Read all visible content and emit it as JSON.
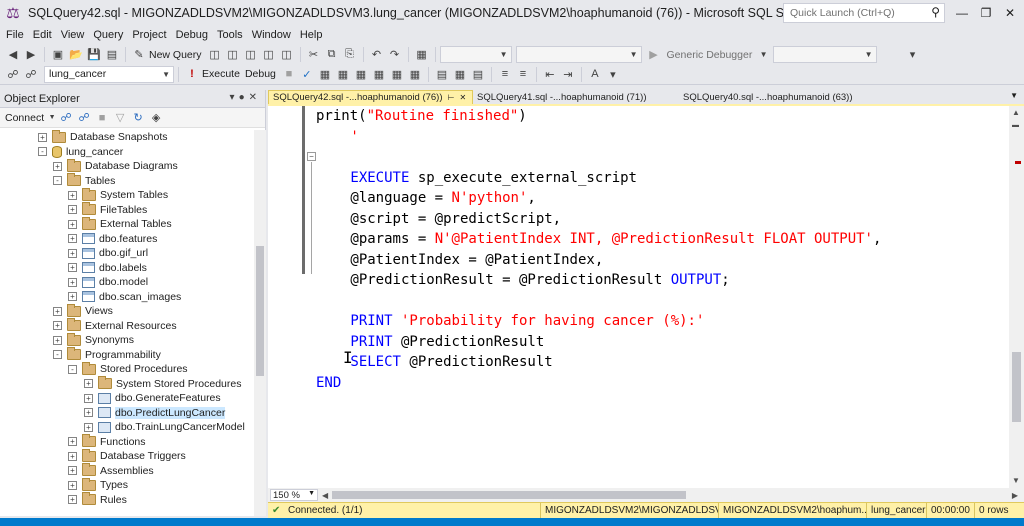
{
  "window": {
    "title": "SQLQuery42.sql - MIGONZADLDSVM2\\MIGONZADLDSVM3.lung_cancer (MIGONZADLDSVM2\\hoaphumanoid (76)) - Microsoft SQL Server...",
    "quick_launch_placeholder": "Quick Launch (Ctrl+Q)"
  },
  "menu": [
    "File",
    "Edit",
    "View",
    "Query",
    "Project",
    "Debug",
    "Tools",
    "Window",
    "Help"
  ],
  "toolbar1": {
    "new_query": "New Query",
    "debugger": "Generic Debugger"
  },
  "toolbar2": {
    "database": "lung_cancer",
    "execute": "Execute",
    "debug": "Debug"
  },
  "object_explorer": {
    "title": "Object Explorer",
    "connect": "Connect",
    "tree": [
      {
        "label": "Database Snapshots",
        "icon": "folder-icon",
        "level": 2,
        "expander": "+"
      },
      {
        "label": "lung_cancer",
        "icon": "database-icon",
        "level": 2,
        "expander": "-"
      },
      {
        "label": "Database Diagrams",
        "icon": "folder-icon",
        "level": 3,
        "expander": "+"
      },
      {
        "label": "Tables",
        "icon": "folder-icon",
        "level": 3,
        "expander": "-"
      },
      {
        "label": "System Tables",
        "icon": "folder-icon",
        "level": 4,
        "expander": "+"
      },
      {
        "label": "FileTables",
        "icon": "folder-icon",
        "level": 4,
        "expander": "+"
      },
      {
        "label": "External Tables",
        "icon": "folder-icon",
        "level": 4,
        "expander": "+"
      },
      {
        "label": "dbo.features",
        "icon": "table-icon",
        "level": 4,
        "expander": "+"
      },
      {
        "label": "dbo.gif_url",
        "icon": "table-icon",
        "level": 4,
        "expander": "+"
      },
      {
        "label": "dbo.labels",
        "icon": "table-icon",
        "level": 4,
        "expander": "+"
      },
      {
        "label": "dbo.model",
        "icon": "table-icon",
        "level": 4,
        "expander": "+"
      },
      {
        "label": "dbo.scan_images",
        "icon": "table-icon",
        "level": 4,
        "expander": "+"
      },
      {
        "label": "Views",
        "icon": "folder-icon",
        "level": 3,
        "expander": "+"
      },
      {
        "label": "External Resources",
        "icon": "folder-icon",
        "level": 3,
        "expander": "+"
      },
      {
        "label": "Synonyms",
        "icon": "folder-icon",
        "level": 3,
        "expander": "+"
      },
      {
        "label": "Programmability",
        "icon": "folder-icon",
        "level": 3,
        "expander": "-"
      },
      {
        "label": "Stored Procedures",
        "icon": "folder-icon",
        "level": 4,
        "expander": "-"
      },
      {
        "label": "System Stored Procedures",
        "icon": "folder-icon",
        "level": 5,
        "expander": "+"
      },
      {
        "label": "dbo.GenerateFeatures",
        "icon": "procedure-icon",
        "level": 5,
        "expander": "+"
      },
      {
        "label": "dbo.PredictLungCancer",
        "icon": "procedure-icon",
        "level": 5,
        "expander": "+",
        "selected": true
      },
      {
        "label": "dbo.TrainLungCancerModel",
        "icon": "procedure-icon",
        "level": 5,
        "expander": "+"
      },
      {
        "label": "Functions",
        "icon": "folder-icon",
        "level": 4,
        "expander": "+"
      },
      {
        "label": "Database Triggers",
        "icon": "folder-icon",
        "level": 4,
        "expander": "+"
      },
      {
        "label": "Assemblies",
        "icon": "folder-icon",
        "level": 4,
        "expander": "+"
      },
      {
        "label": "Types",
        "icon": "folder-icon",
        "level": 4,
        "expander": "+"
      },
      {
        "label": "Rules",
        "icon": "folder-icon",
        "level": 4,
        "expander": "+"
      }
    ]
  },
  "tabs": [
    {
      "label": "SQLQuery42.sql -...hoaphumanoid (76))",
      "active": true
    },
    {
      "label": "SQLQuery41.sql -...hoaphumanoid (71))",
      "active": false
    },
    {
      "label": "SQLQuery40.sql -...hoaphumanoid (63))",
      "active": false
    }
  ],
  "code_lines": [
    {
      "indent": 0,
      "tokens": [
        {
          "t": "print(",
          "c": "text"
        },
        {
          "t": "\"Routine finished\"",
          "c": "str"
        },
        {
          "t": ")",
          "c": "text"
        }
      ]
    },
    {
      "indent": 4,
      "tokens": [
        {
          "t": "'",
          "c": "str"
        }
      ]
    },
    {
      "indent": 0,
      "tokens": []
    },
    {
      "indent": 4,
      "tokens": [
        {
          "t": "EXECUTE",
          "c": "kw"
        },
        {
          "t": " sp_execute_external_script",
          "c": "text"
        }
      ]
    },
    {
      "indent": 4,
      "tokens": [
        {
          "t": "@language = ",
          "c": "text"
        },
        {
          "t": "N'python'",
          "c": "str"
        },
        {
          "t": ",",
          "c": "text"
        }
      ]
    },
    {
      "indent": 4,
      "tokens": [
        {
          "t": "@script = @predictScript,",
          "c": "text"
        }
      ]
    },
    {
      "indent": 4,
      "tokens": [
        {
          "t": "@params = ",
          "c": "text"
        },
        {
          "t": "N'@PatientIndex INT, @PredictionResult FLOAT OUTPUT'",
          "c": "str"
        },
        {
          "t": ",",
          "c": "text"
        }
      ]
    },
    {
      "indent": 4,
      "tokens": [
        {
          "t": "@PatientIndex = @PatientIndex,",
          "c": "text"
        }
      ]
    },
    {
      "indent": 4,
      "tokens": [
        {
          "t": "@PredictionResult = @PredictionResult ",
          "c": "text"
        },
        {
          "t": "OUTPUT",
          "c": "kw"
        },
        {
          "t": ";",
          "c": "text"
        }
      ]
    },
    {
      "indent": 0,
      "tokens": []
    },
    {
      "indent": 4,
      "tokens": [
        {
          "t": "PRINT",
          "c": "kw"
        },
        {
          "t": " ",
          "c": "text"
        },
        {
          "t": "'Probability for having cancer (%):'",
          "c": "str"
        }
      ]
    },
    {
      "indent": 4,
      "tokens": [
        {
          "t": "PRINT",
          "c": "kw"
        },
        {
          "t": " @PredictionResult",
          "c": "text"
        }
      ]
    },
    {
      "indent": 4,
      "tokens": [
        {
          "t": "SELECT",
          "c": "kw"
        },
        {
          "t": " @PredictionResult",
          "c": "text"
        }
      ]
    },
    {
      "indent": 0,
      "tokens": [
        {
          "t": "END",
          "c": "kw"
        }
      ]
    }
  ],
  "zoom": "150 %",
  "status": {
    "connection": "Connected. (1/1)",
    "server": "MIGONZADLDSVM2\\MIGONZADLDSV...",
    "user": "MIGONZADLDSVM2\\hoaphum...",
    "database": "lung_cancer",
    "elapsed": "00:00:00",
    "rows": "0 rows"
  },
  "colors": {
    "keyword": "#0000ff",
    "string": "#ff0000",
    "active_tab": "#fff1a8",
    "status_bar": "#fff1a8",
    "accent": "#007acc"
  }
}
